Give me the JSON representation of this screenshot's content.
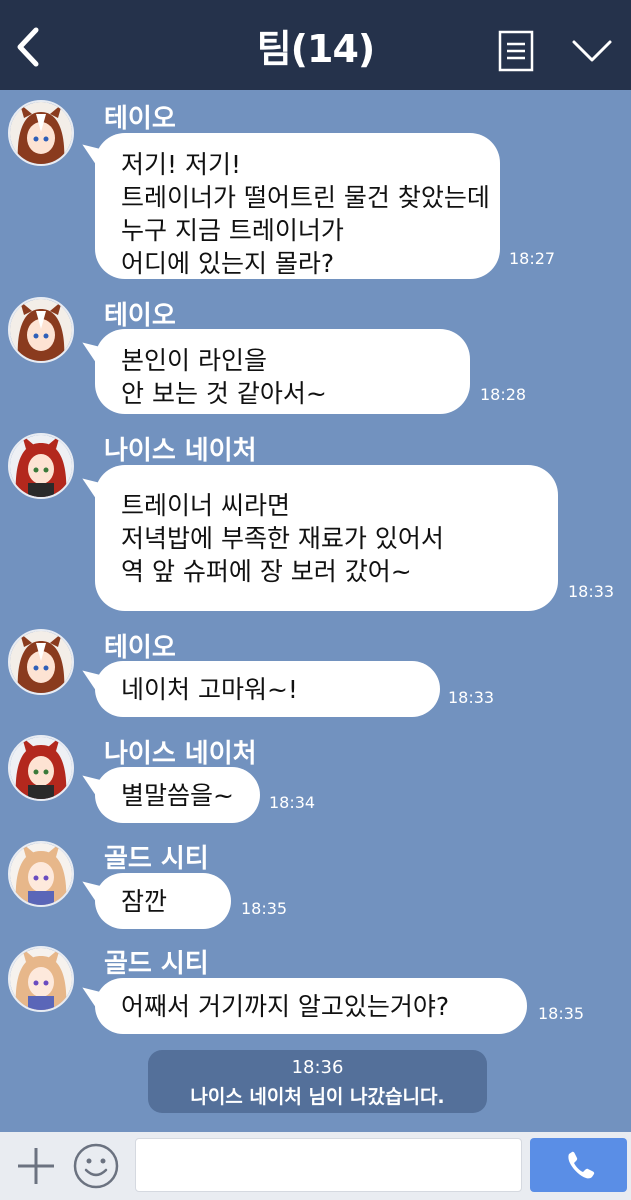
{
  "header": {
    "title": "팀(14)",
    "back_icon": "chevron-left-icon",
    "menu_icon": "document-icon",
    "down_icon": "chevron-down-icon"
  },
  "messages": [
    {
      "sender": "테이오",
      "avatar": "teio",
      "lines": [
        "저기! 저기!",
        "트레이너가 떨어트린 물건 찾았는데",
        "누구 지금 트레이너가",
        "어디에 있는지 몰라?"
      ],
      "time": "18:27"
    },
    {
      "sender": "테이오",
      "avatar": "teio",
      "lines": [
        "본인이 라인을",
        "안 보는 것 같아서~"
      ],
      "time": "18:28"
    },
    {
      "sender": "나이스 네이처",
      "avatar": "nature",
      "lines": [
        "트레이너 씨라면",
        "저녁밥에 부족한 재료가 있어서",
        "역 앞 슈퍼에 장 보러 갔어~"
      ],
      "time": "18:33"
    },
    {
      "sender": "테이오",
      "avatar": "teio",
      "lines": [
        "네이처 고마워~!"
      ],
      "time": "18:33"
    },
    {
      "sender": "나이스 네이처",
      "avatar": "nature",
      "lines": [
        "별말씀을~"
      ],
      "time": "18:34"
    },
    {
      "sender": "골드 시티",
      "avatar": "city",
      "lines": [
        "잠깐"
      ],
      "time": "18:35"
    },
    {
      "sender": "골드 시티",
      "avatar": "city",
      "lines": [
        "어째서 거기까지 알고있는거야?"
      ],
      "time": "18:35"
    }
  ],
  "system_notice": {
    "time": "18:36",
    "text": "나이스 네이처 님이 나갔습니다."
  },
  "input_bar": {
    "plus_icon": "plus-icon",
    "emoji_icon": "emoji-icon",
    "message_value": "",
    "call_icon": "phone-icon"
  },
  "colors": {
    "header_bg": "#25324b",
    "chat_bg": "#7292bf",
    "bubble_bg": "#ffffff",
    "notice_bg": "#54709a",
    "call_button": "#5a8ee6",
    "teio_hair": "#8a3b1e",
    "nature_hair": "#b3281d",
    "city_hair": "#e7b78a"
  }
}
